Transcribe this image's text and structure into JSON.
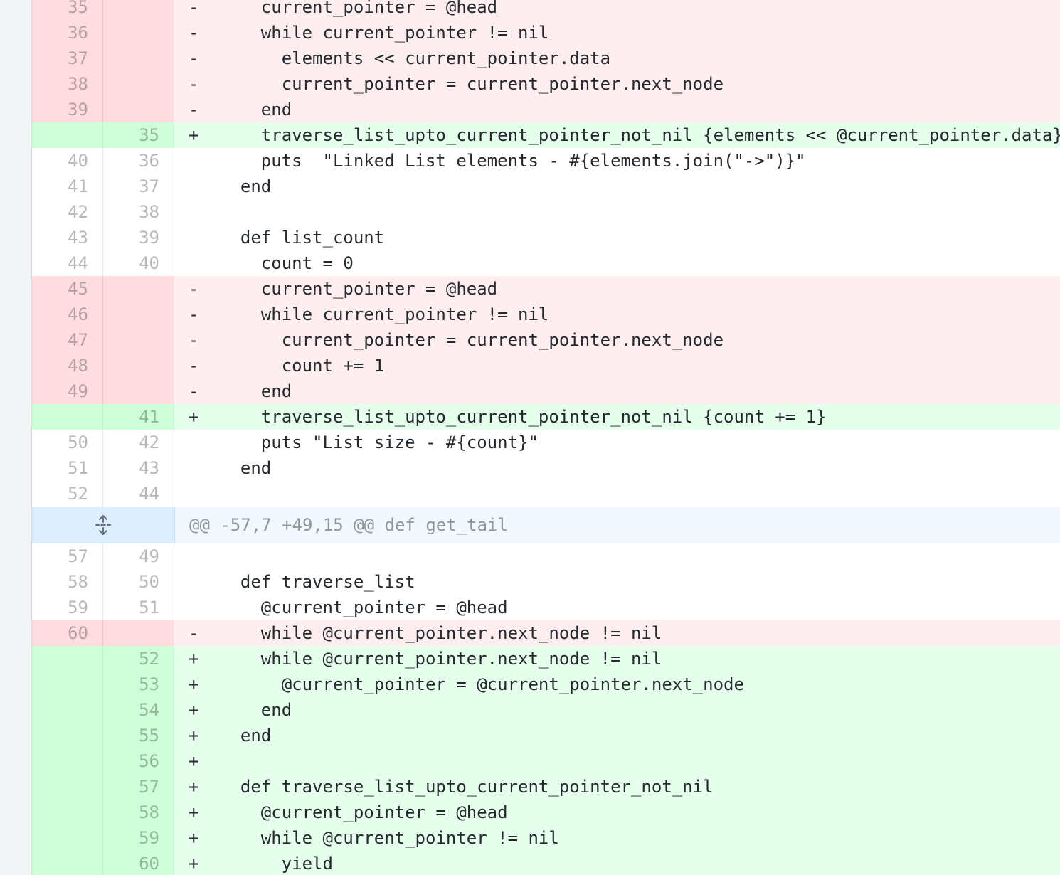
{
  "diff": {
    "rows": [
      {
        "type": "del",
        "old": "35",
        "new": "",
        "sign": "-",
        "code": "    current_pointer = @head"
      },
      {
        "type": "del",
        "old": "36",
        "new": "",
        "sign": "-",
        "code": "    while current_pointer != nil"
      },
      {
        "type": "del",
        "old": "37",
        "new": "",
        "sign": "-",
        "code": "      elements << current_pointer.data"
      },
      {
        "type": "del",
        "old": "38",
        "new": "",
        "sign": "-",
        "code": "      current_pointer = current_pointer.next_node"
      },
      {
        "type": "del",
        "old": "39",
        "new": "",
        "sign": "-",
        "code": "    end"
      },
      {
        "type": "add",
        "old": "",
        "new": "35",
        "sign": "+",
        "code": "    traverse_list_upto_current_pointer_not_nil {elements << @current_pointer.data}"
      },
      {
        "type": "context",
        "old": "40",
        "new": "36",
        "sign": "",
        "code": "    puts  \"Linked List elements - #{elements.join(\"->\")}\""
      },
      {
        "type": "context",
        "old": "41",
        "new": "37",
        "sign": "",
        "code": "  end"
      },
      {
        "type": "context",
        "old": "42",
        "new": "38",
        "sign": "",
        "code": ""
      },
      {
        "type": "context",
        "old": "43",
        "new": "39",
        "sign": "",
        "code": "  def list_count"
      },
      {
        "type": "context",
        "old": "44",
        "new": "40",
        "sign": "",
        "code": "    count = 0"
      },
      {
        "type": "del",
        "old": "45",
        "new": "",
        "sign": "-",
        "code": "    current_pointer = @head"
      },
      {
        "type": "del",
        "old": "46",
        "new": "",
        "sign": "-",
        "code": "    while current_pointer != nil"
      },
      {
        "type": "del",
        "old": "47",
        "new": "",
        "sign": "-",
        "code": "      current_pointer = current_pointer.next_node"
      },
      {
        "type": "del",
        "old": "48",
        "new": "",
        "sign": "-",
        "code": "      count += 1"
      },
      {
        "type": "del",
        "old": "49",
        "new": "",
        "sign": "-",
        "code": "    end"
      },
      {
        "type": "add",
        "old": "",
        "new": "41",
        "sign": "+",
        "code": "    traverse_list_upto_current_pointer_not_nil {count += 1}"
      },
      {
        "type": "context",
        "old": "50",
        "new": "42",
        "sign": "",
        "code": "    puts \"List size - #{count}\""
      },
      {
        "type": "context",
        "old": "51",
        "new": "43",
        "sign": "",
        "code": "  end"
      },
      {
        "type": "context",
        "old": "52",
        "new": "44",
        "sign": "",
        "code": ""
      },
      {
        "type": "hunk",
        "text": "@@ -57,7 +49,15 @@ def get_tail"
      },
      {
        "type": "context",
        "old": "57",
        "new": "49",
        "sign": "",
        "code": ""
      },
      {
        "type": "context",
        "old": "58",
        "new": "50",
        "sign": "",
        "code": "  def traverse_list"
      },
      {
        "type": "context",
        "old": "59",
        "new": "51",
        "sign": "",
        "code": "    @current_pointer = @head"
      },
      {
        "type": "del",
        "old": "60",
        "new": "",
        "sign": "-",
        "code": "    while @current_pointer.next_node != nil"
      },
      {
        "type": "add",
        "old": "",
        "new": "52",
        "sign": "+",
        "code": "    while @current_pointer.next_node != nil"
      },
      {
        "type": "add",
        "old": "",
        "new": "53",
        "sign": "+",
        "code": "      @current_pointer = @current_pointer.next_node"
      },
      {
        "type": "add",
        "old": "",
        "new": "54",
        "sign": "+",
        "code": "    end"
      },
      {
        "type": "add",
        "old": "",
        "new": "55",
        "sign": "+",
        "code": "  end"
      },
      {
        "type": "add",
        "old": "",
        "new": "56",
        "sign": "+",
        "code": ""
      },
      {
        "type": "add",
        "old": "",
        "new": "57",
        "sign": "+",
        "code": "  def traverse_list_upto_current_pointer_not_nil"
      },
      {
        "type": "add",
        "old": "",
        "new": "58",
        "sign": "+",
        "code": "    @current_pointer = @head"
      },
      {
        "type": "add",
        "old": "",
        "new": "59",
        "sign": "+",
        "code": "    while @current_pointer != nil"
      },
      {
        "type": "add",
        "old": "",
        "new": "60",
        "sign": "+",
        "code": "      yield"
      }
    ],
    "expand_icon": "unfold-icon"
  },
  "colors": {
    "deleted_line_bg": "#ffeef0",
    "deleted_number_bg": "#ffdce0",
    "added_line_bg": "#e6ffed",
    "added_number_bg": "#cdffd8",
    "hunk_bg": "#f1f8ff",
    "hunk_expand_bg": "#dbedff"
  }
}
